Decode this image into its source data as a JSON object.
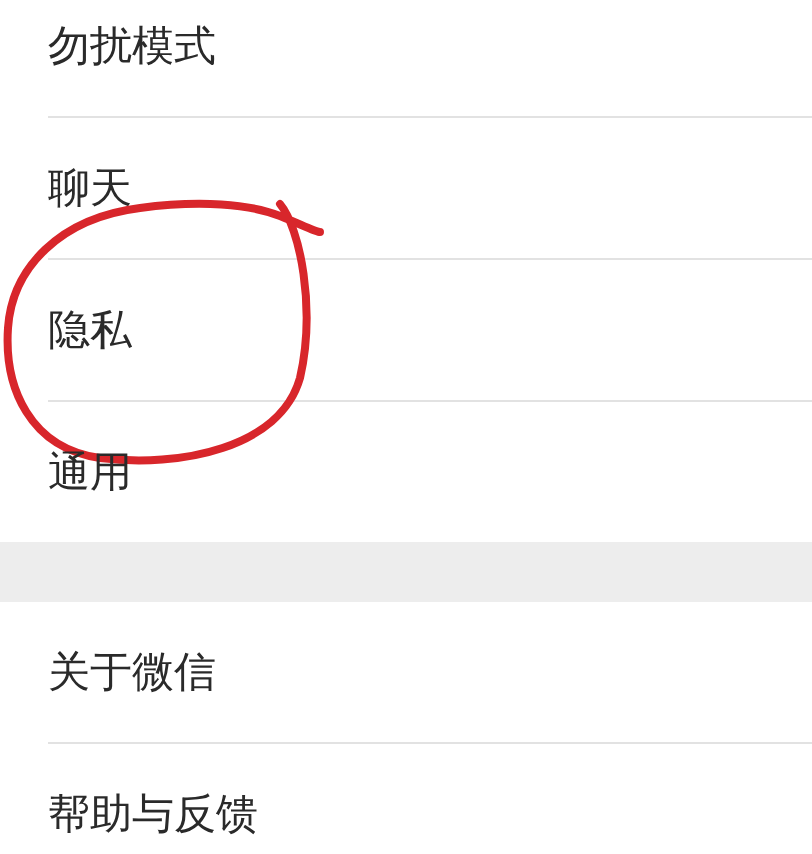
{
  "sections": [
    {
      "rows": [
        {
          "label": "勿扰模式",
          "circled": false
        },
        {
          "label": "聊天",
          "circled": false
        },
        {
          "label": "隐私",
          "circled": true
        },
        {
          "label": "通用",
          "circled": false
        }
      ]
    },
    {
      "rows": [
        {
          "label": "关于微信",
          "circled": false
        },
        {
          "label": "帮助与反馈",
          "circled": false
        }
      ]
    }
  ]
}
